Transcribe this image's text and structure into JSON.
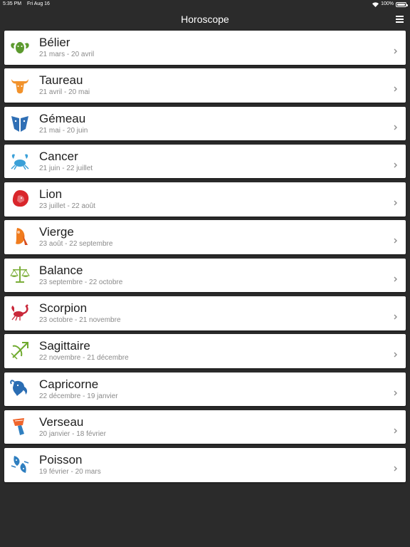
{
  "status": {
    "time": "5:35 PM",
    "date": "Fri Aug 16",
    "battery": "100%"
  },
  "nav": {
    "title": "Horoscope",
    "menu_icon": "hamburger-menu-icon"
  },
  "colors": {
    "background": "#2b2b2b",
    "card": "#ffffff",
    "name_text": "#1e1e1e",
    "date_text": "#8a8a8a"
  },
  "signs": [
    {
      "name": "Bélier",
      "dates": "21 mars - 20 avril",
      "icon": "ram-icon",
      "color": "#5c9a2e"
    },
    {
      "name": "Taureau",
      "dates": "21 avril - 20 mai",
      "icon": "bull-icon",
      "color": "#f2922b"
    },
    {
      "name": "Gémeau",
      "dates": "21 mai - 20 juin",
      "icon": "twins-icon",
      "color": "#2f6fb5"
    },
    {
      "name": "Cancer",
      "dates": "21 juin - 22 juillet",
      "icon": "crab-icon",
      "color": "#3aa0d8"
    },
    {
      "name": "Lion",
      "dates": "23 juillet - 22 août",
      "icon": "lion-icon",
      "color": "#d9262b"
    },
    {
      "name": "Vierge",
      "dates": "23 août - 22 septembre",
      "icon": "virgin-icon",
      "color": "#f07c1e"
    },
    {
      "name": "Balance",
      "dates": "23 septembre - 22 octobre",
      "icon": "scales-icon",
      "color": "#7cae3a"
    },
    {
      "name": "Scorpion",
      "dates": "23 octobre - 21 novembre",
      "icon": "scorpion-icon",
      "color": "#c9283a"
    },
    {
      "name": "Sagittaire",
      "dates": "22 novembre - 21 décembre",
      "icon": "archer-icon",
      "color": "#6faa2e"
    },
    {
      "name": "Capricorne",
      "dates": "22 décembre - 19 janvier",
      "icon": "goat-icon",
      "color": "#2a6db3"
    },
    {
      "name": "Verseau",
      "dates": "20 janvier - 18 février",
      "icon": "water-bearer-icon",
      "color": "#f0652b"
    },
    {
      "name": "Poisson",
      "dates": "19 février - 20 mars",
      "icon": "fish-icon",
      "color": "#2f7fc0"
    }
  ]
}
